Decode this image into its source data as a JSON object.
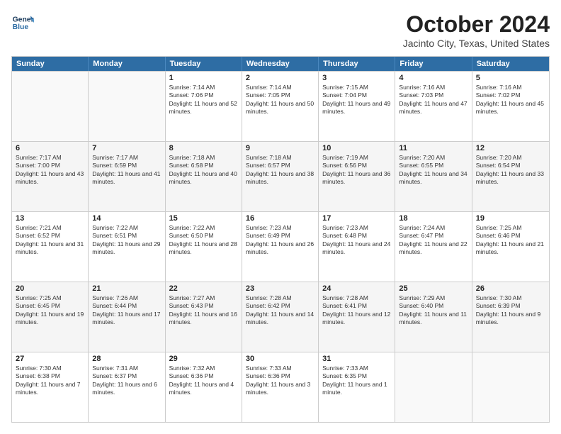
{
  "header": {
    "logo": {
      "line1": "General",
      "line2": "Blue"
    },
    "title": "October 2024",
    "location": "Jacinto City, Texas, United States"
  },
  "weekdays": [
    "Sunday",
    "Monday",
    "Tuesday",
    "Wednesday",
    "Thursday",
    "Friday",
    "Saturday"
  ],
  "weeks": [
    [
      {
        "day": "",
        "empty": true
      },
      {
        "day": "",
        "empty": true
      },
      {
        "day": "1",
        "sunrise": "7:14 AM",
        "sunset": "7:06 PM",
        "daylight": "11 hours and 52 minutes."
      },
      {
        "day": "2",
        "sunrise": "7:14 AM",
        "sunset": "7:05 PM",
        "daylight": "11 hours and 50 minutes."
      },
      {
        "day": "3",
        "sunrise": "7:15 AM",
        "sunset": "7:04 PM",
        "daylight": "11 hours and 49 minutes."
      },
      {
        "day": "4",
        "sunrise": "7:16 AM",
        "sunset": "7:03 PM",
        "daylight": "11 hours and 47 minutes."
      },
      {
        "day": "5",
        "sunrise": "7:16 AM",
        "sunset": "7:02 PM",
        "daylight": "11 hours and 45 minutes."
      }
    ],
    [
      {
        "day": "6",
        "sunrise": "7:17 AM",
        "sunset": "7:00 PM",
        "daylight": "11 hours and 43 minutes."
      },
      {
        "day": "7",
        "sunrise": "7:17 AM",
        "sunset": "6:59 PM",
        "daylight": "11 hours and 41 minutes."
      },
      {
        "day": "8",
        "sunrise": "7:18 AM",
        "sunset": "6:58 PM",
        "daylight": "11 hours and 40 minutes."
      },
      {
        "day": "9",
        "sunrise": "7:18 AM",
        "sunset": "6:57 PM",
        "daylight": "11 hours and 38 minutes."
      },
      {
        "day": "10",
        "sunrise": "7:19 AM",
        "sunset": "6:56 PM",
        "daylight": "11 hours and 36 minutes."
      },
      {
        "day": "11",
        "sunrise": "7:20 AM",
        "sunset": "6:55 PM",
        "daylight": "11 hours and 34 minutes."
      },
      {
        "day": "12",
        "sunrise": "7:20 AM",
        "sunset": "6:54 PM",
        "daylight": "11 hours and 33 minutes."
      }
    ],
    [
      {
        "day": "13",
        "sunrise": "7:21 AM",
        "sunset": "6:52 PM",
        "daylight": "11 hours and 31 minutes."
      },
      {
        "day": "14",
        "sunrise": "7:22 AM",
        "sunset": "6:51 PM",
        "daylight": "11 hours and 29 minutes."
      },
      {
        "day": "15",
        "sunrise": "7:22 AM",
        "sunset": "6:50 PM",
        "daylight": "11 hours and 28 minutes."
      },
      {
        "day": "16",
        "sunrise": "7:23 AM",
        "sunset": "6:49 PM",
        "daylight": "11 hours and 26 minutes."
      },
      {
        "day": "17",
        "sunrise": "7:23 AM",
        "sunset": "6:48 PM",
        "daylight": "11 hours and 24 minutes."
      },
      {
        "day": "18",
        "sunrise": "7:24 AM",
        "sunset": "6:47 PM",
        "daylight": "11 hours and 22 minutes."
      },
      {
        "day": "19",
        "sunrise": "7:25 AM",
        "sunset": "6:46 PM",
        "daylight": "11 hours and 21 minutes."
      }
    ],
    [
      {
        "day": "20",
        "sunrise": "7:25 AM",
        "sunset": "6:45 PM",
        "daylight": "11 hours and 19 minutes."
      },
      {
        "day": "21",
        "sunrise": "7:26 AM",
        "sunset": "6:44 PM",
        "daylight": "11 hours and 17 minutes."
      },
      {
        "day": "22",
        "sunrise": "7:27 AM",
        "sunset": "6:43 PM",
        "daylight": "11 hours and 16 minutes."
      },
      {
        "day": "23",
        "sunrise": "7:28 AM",
        "sunset": "6:42 PM",
        "daylight": "11 hours and 14 minutes."
      },
      {
        "day": "24",
        "sunrise": "7:28 AM",
        "sunset": "6:41 PM",
        "daylight": "11 hours and 12 minutes."
      },
      {
        "day": "25",
        "sunrise": "7:29 AM",
        "sunset": "6:40 PM",
        "daylight": "11 hours and 11 minutes."
      },
      {
        "day": "26",
        "sunrise": "7:30 AM",
        "sunset": "6:39 PM",
        "daylight": "11 hours and 9 minutes."
      }
    ],
    [
      {
        "day": "27",
        "sunrise": "7:30 AM",
        "sunset": "6:38 PM",
        "daylight": "11 hours and 7 minutes."
      },
      {
        "day": "28",
        "sunrise": "7:31 AM",
        "sunset": "6:37 PM",
        "daylight": "11 hours and 6 minutes."
      },
      {
        "day": "29",
        "sunrise": "7:32 AM",
        "sunset": "6:36 PM",
        "daylight": "11 hours and 4 minutes."
      },
      {
        "day": "30",
        "sunrise": "7:33 AM",
        "sunset": "6:36 PM",
        "daylight": "11 hours and 3 minutes."
      },
      {
        "day": "31",
        "sunrise": "7:33 AM",
        "sunset": "6:35 PM",
        "daylight": "11 hours and 1 minute."
      },
      {
        "day": "",
        "empty": true
      },
      {
        "day": "",
        "empty": true
      }
    ]
  ]
}
